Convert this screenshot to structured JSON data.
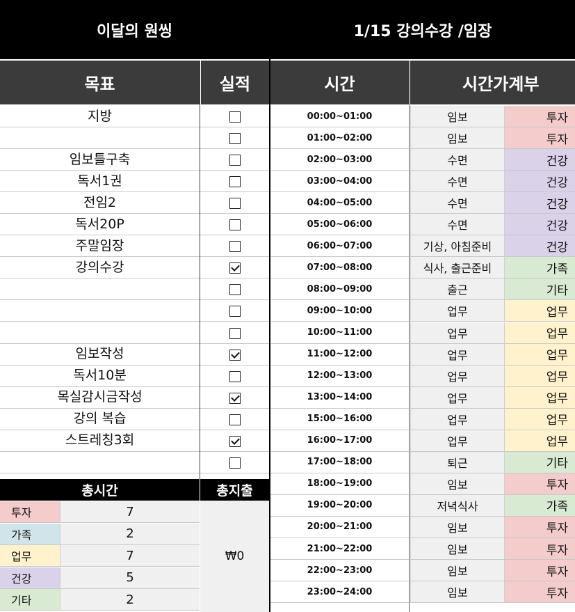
{
  "header": {
    "left_title": "이달의 원씽",
    "right_title": "1/15 강의수강 /임장"
  },
  "columns": {
    "goal": "목표",
    "result": "실적",
    "time": "시간",
    "budget": "시간가계부"
  },
  "category_colors": {
    "투자": "#f4cccc",
    "건강": "#d9d2e9",
    "가족": "#d9ead3",
    "기타": "#d9ead3",
    "업무": "#fff2cc"
  },
  "rows": [
    {
      "goal": "지방",
      "checked": false,
      "time": "00:00~01:00",
      "activity": "임보",
      "category": "투자"
    },
    {
      "goal": "",
      "checked": false,
      "time": "01:00~02:00",
      "activity": "임보",
      "category": "투자"
    },
    {
      "goal": "임보틀구축",
      "checked": false,
      "time": "02:00~03:00",
      "activity": "수면",
      "category": "건강"
    },
    {
      "goal": "독서1권",
      "checked": false,
      "time": "03:00~04:00",
      "activity": "수면",
      "category": "건강"
    },
    {
      "goal": "전임2",
      "checked": false,
      "time": "04:00~05:00",
      "activity": "수면",
      "category": "건강"
    },
    {
      "goal": "독서20P",
      "checked": false,
      "time": "05:00~06:00",
      "activity": "수면",
      "category": "건강"
    },
    {
      "goal": "주말임장",
      "checked": false,
      "time": "06:00~07:00",
      "activity": "기상, 아침준비",
      "category": "건강"
    },
    {
      "goal": "강의수강",
      "checked": true,
      "time": "07:00~08:00",
      "activity": "식사, 출근준비",
      "category": "가족"
    },
    {
      "goal": "",
      "checked": false,
      "time": "08:00~09:00",
      "activity": "출근",
      "category": "기타"
    },
    {
      "goal": "",
      "checked": false,
      "time": "09:00~10:00",
      "activity": "업무",
      "category": "업무"
    },
    {
      "goal": "",
      "checked": false,
      "time": "10:00~11:00",
      "activity": "업무",
      "category": "업무"
    },
    {
      "goal": "임보작성",
      "checked": true,
      "time": "11:00~12:00",
      "activity": "업무",
      "category": "업무"
    },
    {
      "goal": "독서10분",
      "checked": false,
      "time": "12:00~13:00",
      "activity": "업무",
      "category": "업무"
    },
    {
      "goal": "목실감시금작성",
      "checked": true,
      "time": "13:00~14:00",
      "activity": "업무",
      "category": "업무"
    },
    {
      "goal": "강의 복습",
      "checked": false,
      "time": "15:00~16:00",
      "activity": "업무",
      "category": "업무"
    },
    {
      "goal": "스트레칭3회",
      "checked": true,
      "time": "16:00~17:00",
      "activity": "업무",
      "category": "업무"
    },
    {
      "goal": "",
      "checked": false,
      "time": "17:00~18:00",
      "activity": "퇴근",
      "category": "기타"
    }
  ],
  "later_rows": [
    {
      "time": "18:00~19:00",
      "activity": "임보",
      "category": "투자"
    },
    {
      "time": "19:00~20:00",
      "activity": "저녁식사",
      "category": "가족"
    },
    {
      "time": "20:00~21:00",
      "activity": "임보",
      "category": "투자"
    },
    {
      "time": "21:00~22:00",
      "activity": "임보",
      "category": "투자"
    },
    {
      "time": "22:00~23:00",
      "activity": "임보",
      "category": "투자"
    },
    {
      "time": "23:00~24:00",
      "activity": "임보",
      "category": "투자"
    }
  ],
  "summary": {
    "total_time_label": "총시간",
    "total_spend_label": "총지출",
    "total_spend_value": "₩0",
    "items": [
      {
        "category": "투자",
        "hours": "7",
        "color": "#f4cccc"
      },
      {
        "category": "가족",
        "hours": "2",
        "color": "#d0e4ea"
      },
      {
        "category": "업무",
        "hours": "7",
        "color": "#fff2cc"
      },
      {
        "category": "건강",
        "hours": "5",
        "color": "#d9d2e9"
      },
      {
        "category": "기타",
        "hours": "2",
        "color": "#d9ead3"
      }
    ]
  }
}
